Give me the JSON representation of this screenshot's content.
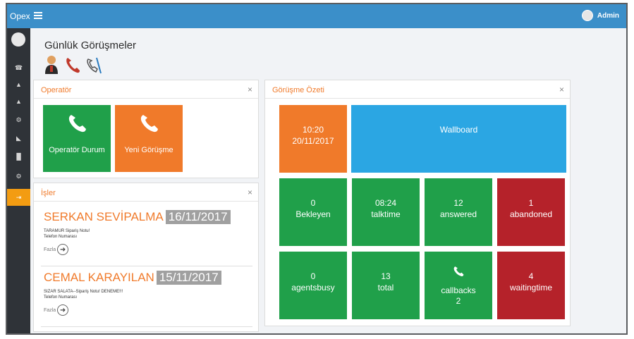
{
  "topbar": {
    "brand": "Opex",
    "user": "Admin"
  },
  "page": {
    "title": "Günlük Görüşmeler"
  },
  "operator_panel": {
    "title": "Operatör",
    "close": "×",
    "tiles": [
      {
        "label": "Operatör Durum",
        "color": "#20a04a"
      },
      {
        "label": "Yeni Görüşme",
        "color": "#f07a2a"
      }
    ]
  },
  "jobs_panel": {
    "title": "İşler",
    "close": "×",
    "items": [
      {
        "name": "SERKAN SEVİPALMA",
        "date": "16/11/2017",
        "line1": "TARAMUR Sipariş Notu!",
        "line2": "Telefon Numarası",
        "more": "Fazla"
      },
      {
        "name": "CEMAL KARAYILAN",
        "date": "15/11/2017",
        "line1": "SIZAR SALATA--Sipariş Notu! DENEME!!!",
        "line2": "Telefon Numarası",
        "more": "Fazla"
      }
    ]
  },
  "summary_panel": {
    "title": "Görüşme Özeti",
    "close": "×",
    "time": "10:20",
    "date": "20/11/2017",
    "wallboard": "Wallboard",
    "stats": [
      {
        "value": "0",
        "label": "Bekleyen",
        "color": "#20a04a"
      },
      {
        "value": "08:24",
        "label": "talktime",
        "color": "#20a04a"
      },
      {
        "value": "12",
        "label": "answered",
        "color": "#20a04a"
      },
      {
        "value": "1",
        "label": "abandoned",
        "color": "#b5222a"
      },
      {
        "value": "0",
        "label": "agentsbusy",
        "color": "#20a04a"
      },
      {
        "value": "13",
        "label": "total",
        "color": "#20a04a"
      },
      {
        "value": "2",
        "label": "callbacks",
        "color": "#20a04a"
      },
      {
        "value": "4",
        "label": "waitingtime",
        "color": "#b5222a"
      }
    ]
  },
  "icons": {
    "sidebar": [
      "phone-icon",
      "user-icon",
      "user-icon",
      "gear-icon",
      "chart-area-icon",
      "bar-chart-icon",
      "gear-icon",
      "logout-icon"
    ],
    "title": [
      "operator-icon",
      "phone-icon",
      "phone-list-icon"
    ]
  }
}
